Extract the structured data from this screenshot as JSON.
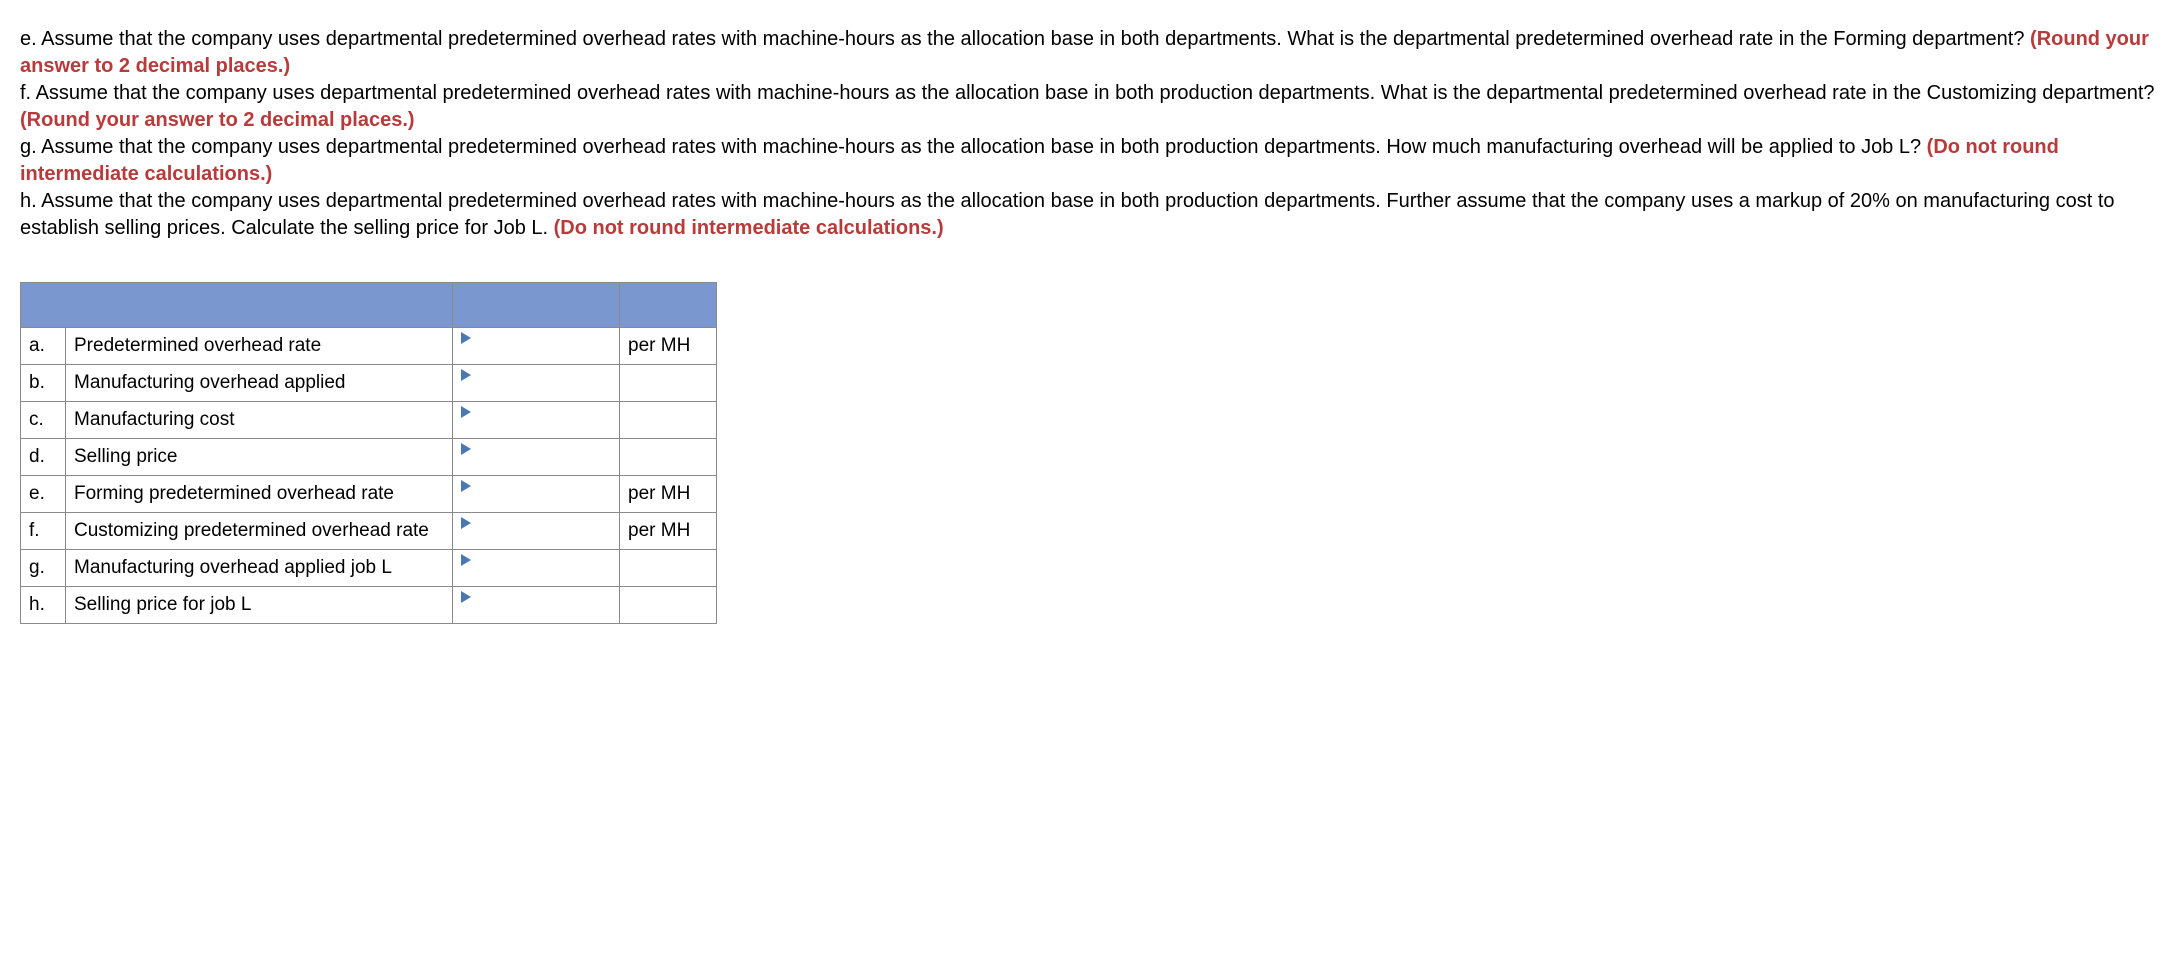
{
  "cutoff_text": "calculations.)",
  "paragraphs": [
    {
      "prefix": "e. ",
      "black": "Assume that the company uses departmental predetermined overhead rates with machine-hours as the allocation base in both departments. What is the departmental predetermined overhead rate in the Forming department? ",
      "red": "(Round your answer to 2 decimal places.)"
    },
    {
      "prefix": "f. ",
      "black": "Assume that the company uses departmental predetermined overhead rates with machine-hours as the allocation base in both production departments. What is the departmental predetermined overhead rate in the Customizing department? ",
      "red": "(Round your answer to 2 decimal places.)"
    },
    {
      "prefix": "g. ",
      "black": "Assume that the company uses departmental predetermined overhead rates with machine-hours as the allocation base in both production departments. How much manufacturing overhead will be applied to Job L? ",
      "red": "(Do not round intermediate calculations.)"
    },
    {
      "prefix": "h. ",
      "black": "Assume that the company uses departmental predetermined overhead rates with machine-hours as the allocation base in both production departments. Further assume that the company uses a markup of 20% on manufacturing cost to establish selling prices. Calculate the selling price for Job L. ",
      "red": "(Do not round intermediate calculations.)"
    }
  ],
  "rows": [
    {
      "letter": "a.",
      "label": "Predetermined overhead rate",
      "unit": "per MH"
    },
    {
      "letter": "b.",
      "label": "Manufacturing overhead applied",
      "unit": ""
    },
    {
      "letter": "c.",
      "label": "Manufacturing cost",
      "unit": ""
    },
    {
      "letter": "d.",
      "label": "Selling price",
      "unit": ""
    },
    {
      "letter": "e.",
      "label": "Forming predetermined overhead rate",
      "unit": "per MH"
    },
    {
      "letter": "f.",
      "label": "Customizing predetermined overhead rate",
      "unit": "per MH"
    },
    {
      "letter": "g.",
      "label": "Manufacturing overhead applied job L",
      "unit": ""
    },
    {
      "letter": "h.",
      "label": "Selling price for job L",
      "unit": ""
    }
  ]
}
